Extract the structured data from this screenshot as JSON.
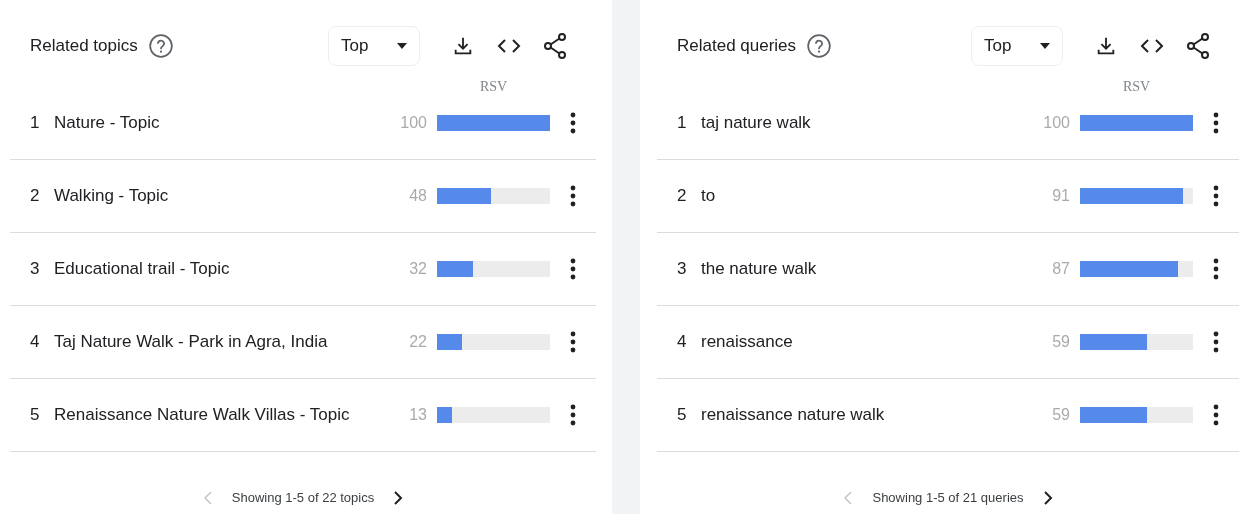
{
  "panels": [
    {
      "title": "Related topics",
      "filter": "Top",
      "value_header": "RSV",
      "rows": [
        {
          "rank": "1",
          "label": "Nature - Topic",
          "value": "100",
          "level": 1.0
        },
        {
          "rank": "2",
          "label": "Walking - Topic",
          "value": "48",
          "level": 0.48
        },
        {
          "rank": "3",
          "label": "Educational trail - Topic",
          "value": "32",
          "level": 0.32
        },
        {
          "rank": "4",
          "label": "Taj Nature Walk - Park in Agra, India",
          "value": "22",
          "level": 0.22
        },
        {
          "rank": "5",
          "label": "Renaissance Nature Walk Villas - Topic",
          "value": "13",
          "level": 0.13
        }
      ],
      "footer": {
        "text": "Showing 1-5 of 22 topics",
        "prev_disabled": true,
        "next_disabled": false
      }
    },
    {
      "title": "Related queries",
      "filter": "Top",
      "value_header": "RSV",
      "rows": [
        {
          "rank": "1",
          "label": "taj nature walk",
          "value": "100",
          "level": 1.0
        },
        {
          "rank": "2",
          "label": "to",
          "value": "91",
          "level": 0.91
        },
        {
          "rank": "3",
          "label": "the nature walk",
          "value": "87",
          "level": 0.87
        },
        {
          "rank": "4",
          "label": "renaissance",
          "value": "59",
          "level": 0.59
        },
        {
          "rank": "5",
          "label": "renaissance nature walk",
          "value": "59",
          "level": 0.59
        }
      ],
      "footer": {
        "text": "Showing 1-5 of 21 queries",
        "prev_disabled": true,
        "next_disabled": false
      }
    }
  ]
}
